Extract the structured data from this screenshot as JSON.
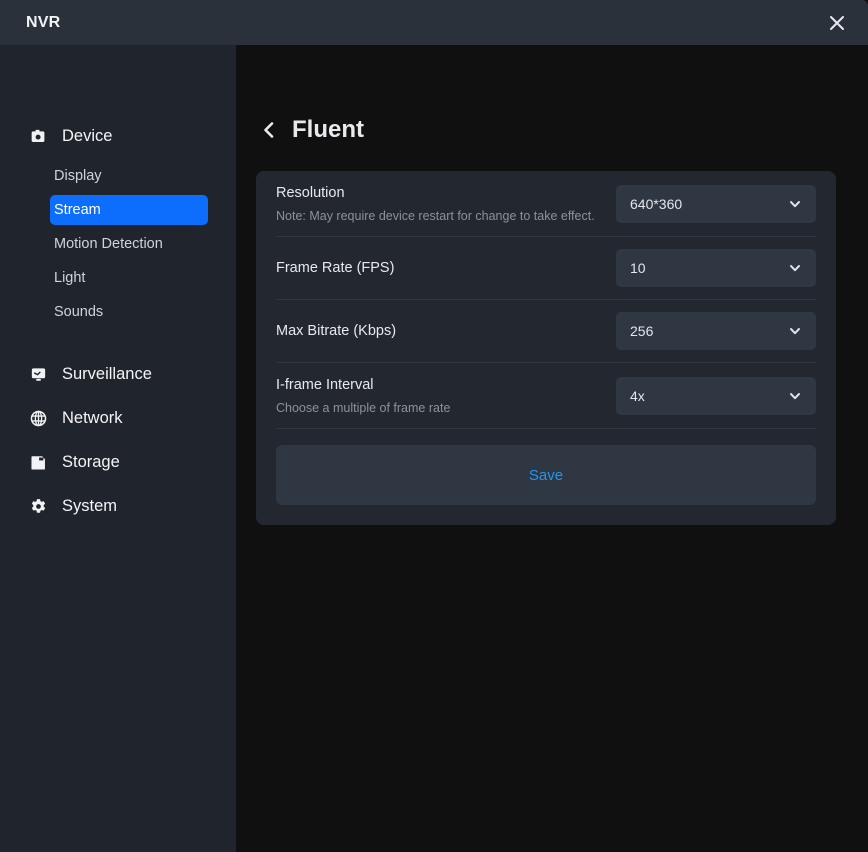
{
  "titlebar": {
    "title": "NVR",
    "close_icon": "close-icon"
  },
  "sidebar": {
    "groups": [
      {
        "label": "Device",
        "icon": "camera-icon",
        "items": [
          {
            "label": "Display",
            "selected": false
          },
          {
            "label": "Stream",
            "selected": true
          },
          {
            "label": "Motion Detection",
            "selected": false
          },
          {
            "label": "Light",
            "selected": false
          },
          {
            "label": "Sounds",
            "selected": false
          }
        ]
      },
      {
        "label": "Surveillance",
        "icon": "monitor-icon",
        "items": []
      },
      {
        "label": "Network",
        "icon": "globe-icon",
        "items": []
      },
      {
        "label": "Storage",
        "icon": "floppy-disk-icon",
        "items": []
      },
      {
        "label": "System",
        "icon": "gear-icon",
        "items": []
      }
    ],
    "selected_color": "#0d6efd"
  },
  "page": {
    "back_icon": "chevron-left-icon",
    "title": "Fluent",
    "settings": [
      {
        "label": "Resolution",
        "note": "Note: May require device restart for change to take effect.",
        "value": "640*360"
      },
      {
        "label": "Frame Rate (FPS)",
        "note": "",
        "value": "10"
      },
      {
        "label": "Max Bitrate (Kbps)",
        "note": "",
        "value": "256"
      },
      {
        "label": "I-frame Interval",
        "note": "Choose a multiple of frame rate",
        "value": "4x"
      }
    ],
    "save_label": "Save",
    "save_color": "#2196f3"
  }
}
